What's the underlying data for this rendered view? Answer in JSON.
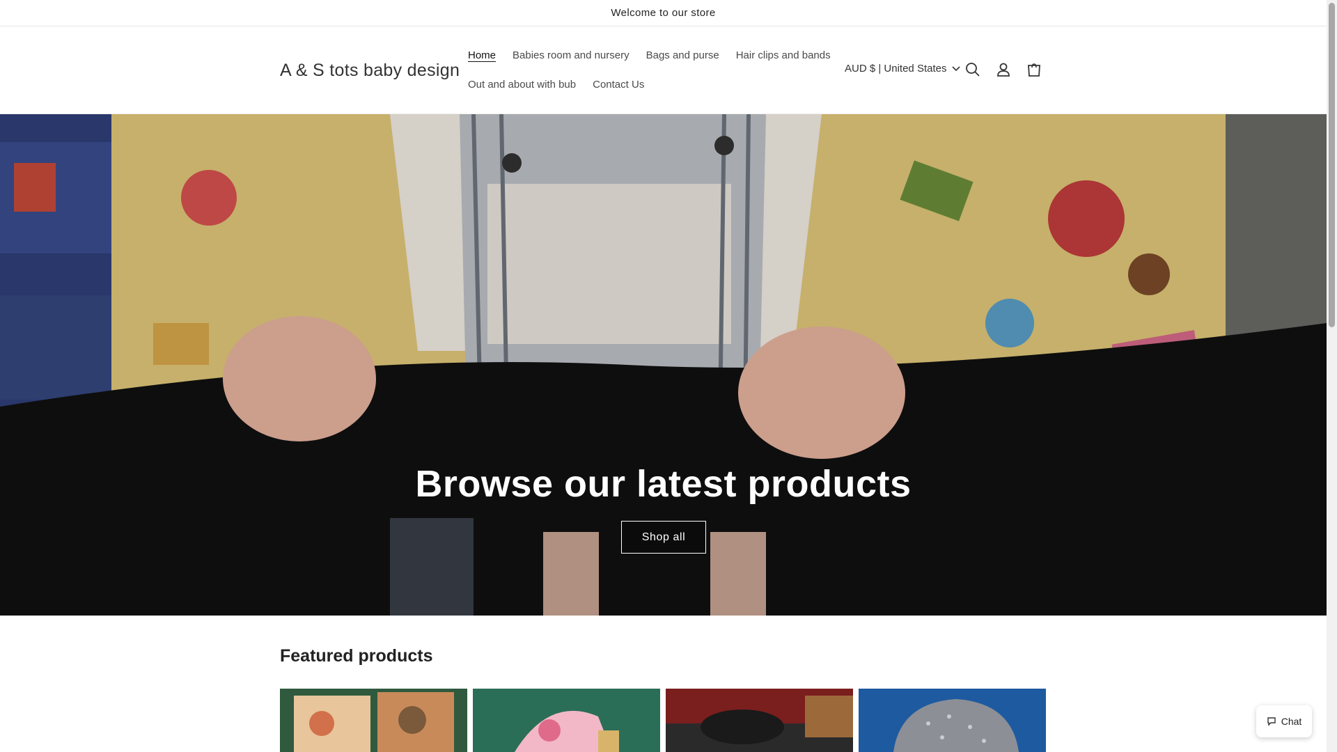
{
  "announcement": {
    "text": "Welcome to our store"
  },
  "header": {
    "logo": "A & S tots baby design",
    "nav": [
      {
        "label": "Home",
        "active": true
      },
      {
        "label": "Babies room and nursery"
      },
      {
        "label": "Bags and purse"
      },
      {
        "label": "Hair clips and bands"
      },
      {
        "label": "Out and about with bub"
      },
      {
        "label": "Contact Us"
      }
    ],
    "currency": "AUD $ | United States",
    "icons": [
      "search-icon",
      "account-icon",
      "cart-icon"
    ]
  },
  "hero": {
    "title": "Browse our latest products",
    "button": "Shop all"
  },
  "featured": {
    "title": "Featured products"
  },
  "chat": {
    "label": "Chat"
  },
  "colors": {
    "text": "#121212",
    "muted": "#4a4a4a",
    "hero_text": "#ffffff"
  }
}
